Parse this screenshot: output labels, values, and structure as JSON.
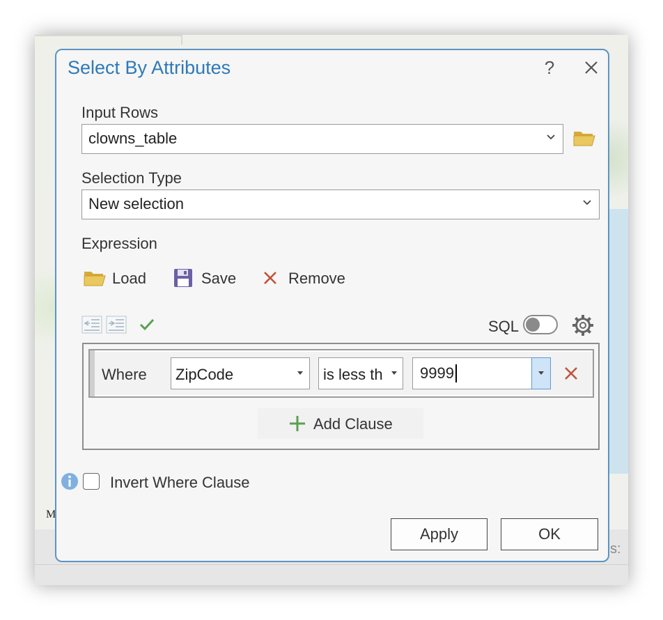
{
  "background": {
    "map_scale_label": "M",
    "map_coords_label": "s:"
  },
  "dialog": {
    "title": "Select By Attributes",
    "help_label": "?",
    "input_rows": {
      "label": "Input Rows",
      "value": "clowns_table"
    },
    "selection_type": {
      "label": "Selection Type",
      "value": "New selection"
    },
    "expression": {
      "label": "Expression",
      "tools": {
        "load_label": "Load",
        "save_label": "Save",
        "remove_label": "Remove"
      },
      "sql_label": "SQL",
      "sql_enabled": false,
      "clauses": [
        {
          "connector": "Where",
          "field": "ZipCode",
          "operator": "is less th",
          "value": "9999"
        }
      ],
      "add_clause_label": "Add Clause"
    },
    "invert_where_clause": {
      "label": "Invert Where Clause",
      "checked": false
    },
    "buttons": {
      "apply_label": "Apply",
      "ok_label": "OK"
    }
  },
  "colors": {
    "title_blue": "#2f79b9",
    "dialog_border": "#5d93c4",
    "folder_yellow": "#e3c158",
    "save_purple": "#6b5fa5",
    "remove_red": "#c0533a",
    "add_green": "#5aa050",
    "info_blue": "#7fb0df"
  },
  "icons": {
    "input_rows_browse": "folder-icon",
    "load": "folder-icon",
    "save": "floppy-disk-icon",
    "remove": "x-icon",
    "outdent": "outdent-icon",
    "indent": "indent-icon",
    "verify": "checkmark-icon",
    "settings": "gear-icon",
    "remove_clause": "x-icon",
    "add_clause": "plus-icon",
    "info": "info-icon",
    "close": "close-icon"
  }
}
